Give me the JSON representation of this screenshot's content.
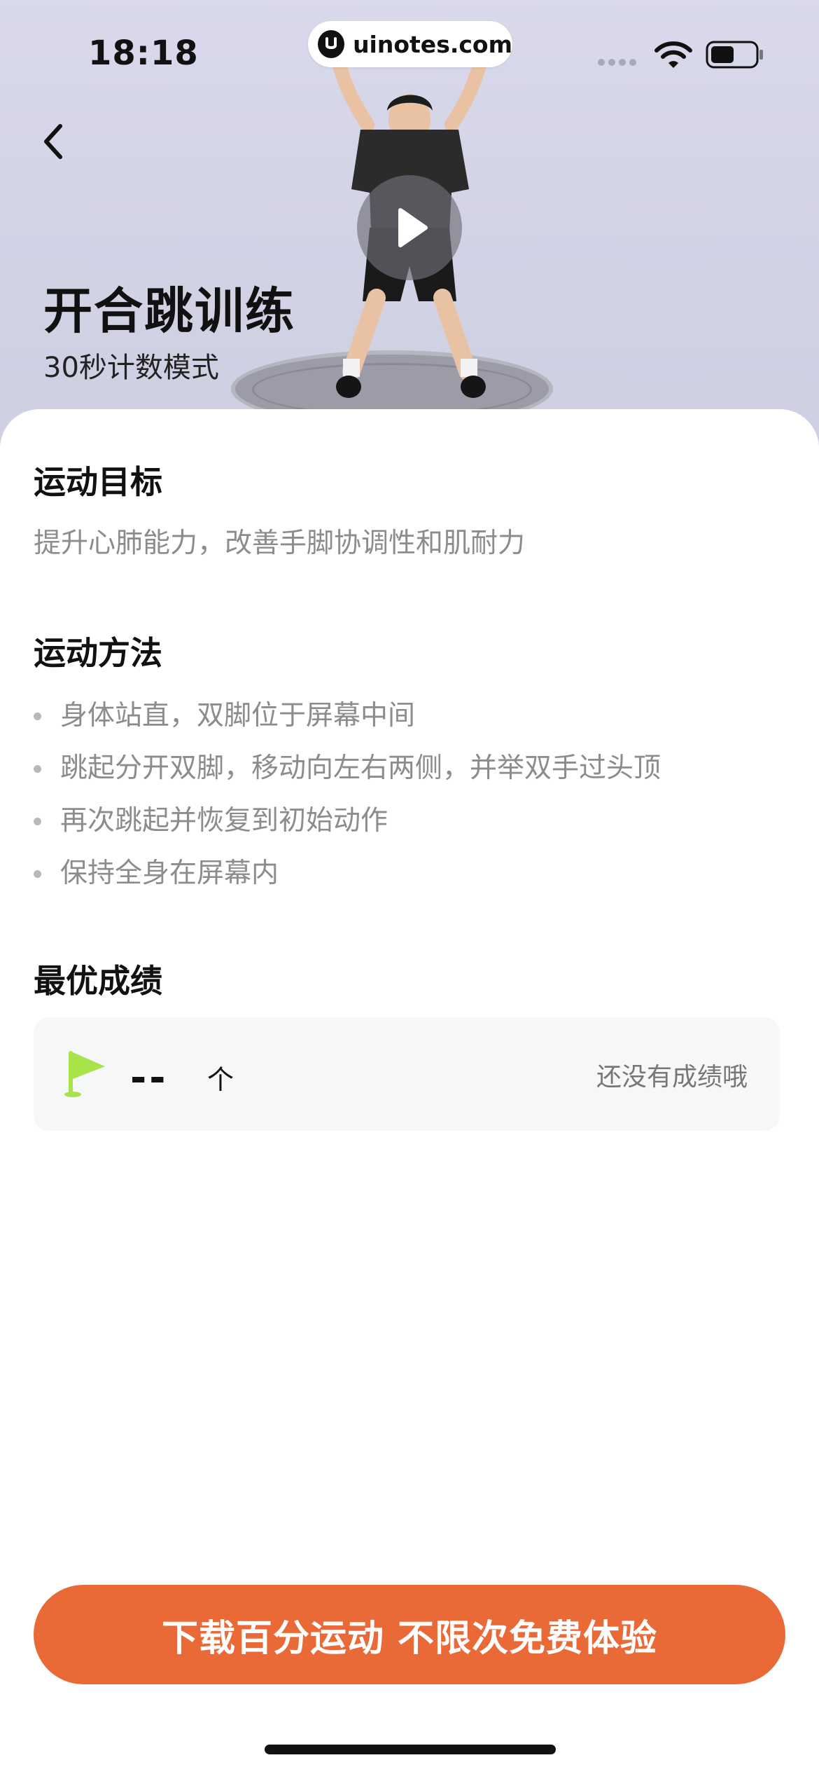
{
  "status_bar": {
    "time": "18:18",
    "url": "uinotes.com"
  },
  "hero": {
    "title": "开合跳训练",
    "subtitle": "30秒计数模式"
  },
  "sections": {
    "goal_title": "运动目标",
    "goal_text": "提升心肺能力，改善手脚协调性和肌耐力",
    "method_title": "运动方法",
    "method_steps": [
      "身体站直，双脚位于屏幕中间",
      "跳起分开双脚，移动向左右两侧，并举双手过头顶",
      "再次跳起并恢复到初始动作",
      "保持全身在屏幕内"
    ],
    "best_title": "最优成绩"
  },
  "best_score": {
    "value": "--",
    "unit": "个",
    "empty_text": "还没有成绩哦"
  },
  "cta": {
    "label": "下载百分运动 不限次免费体验"
  },
  "colors": {
    "accent": "#ea6a37",
    "flag": "#a8e34a",
    "muted_text": "#8c8c8c"
  },
  "icons": [
    "back-icon",
    "play-icon",
    "flag-icon",
    "wifi-icon",
    "battery-icon",
    "uinotes-logo-icon"
  ]
}
